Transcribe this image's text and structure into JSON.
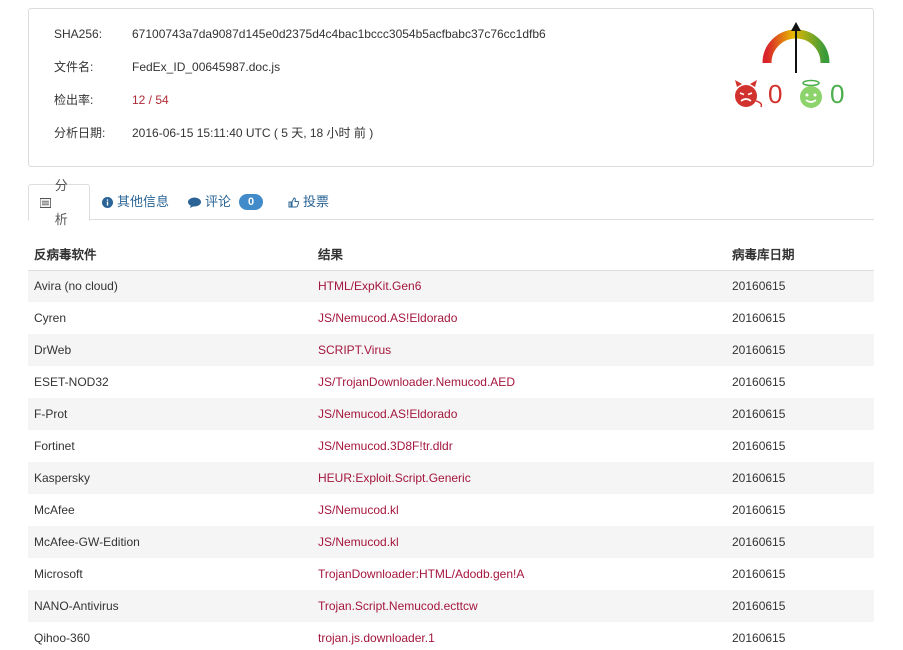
{
  "file_info": {
    "sha256_label": "SHA256:",
    "sha256_value": "67100743a7da9087d145e0d2375d4c4bac1bccc3054b5acfbabc37c76cc1dfb6",
    "filename_label": "文件名:",
    "filename_value": "FedEx_ID_00645987.doc.js",
    "detection_label": "检出率:",
    "detection_value": "12 / 54",
    "date_label": "分析日期:",
    "date_value": "2016-06-15 15:11:40 UTC ( 5 天, 18 小时 前 )"
  },
  "community": {
    "malicious_votes": "0",
    "harmless_votes": "0",
    "colors": {
      "malicious": "#d2322d",
      "harmless": "#4cae4c"
    }
  },
  "tabs": [
    {
      "label": "分析",
      "icon": "list-icon",
      "active": true
    },
    {
      "label": "其他信息",
      "icon": "info-icon",
      "active": false
    },
    {
      "label": "评论",
      "icon": "comment-icon",
      "active": false,
      "badge": "0"
    },
    {
      "label": "投票",
      "icon": "thumbs-icon",
      "active": false
    }
  ],
  "table": {
    "headers": [
      "反病毒软件",
      "结果",
      "病毒库日期"
    ],
    "rows": [
      {
        "av": "Avira (no cloud)",
        "result": "HTML/ExpKit.Gen6",
        "date": "20160615"
      },
      {
        "av": "Cyren",
        "result": "JS/Nemucod.AS!Eldorado",
        "date": "20160615"
      },
      {
        "av": "DrWeb",
        "result": "SCRIPT.Virus",
        "date": "20160615"
      },
      {
        "av": "ESET-NOD32",
        "result": "JS/TrojanDownloader.Nemucod.AED",
        "date": "20160615"
      },
      {
        "av": "F-Prot",
        "result": "JS/Nemucod.AS!Eldorado",
        "date": "20160615"
      },
      {
        "av": "Fortinet",
        "result": "JS/Nemucod.3D8F!tr.dldr",
        "date": "20160615"
      },
      {
        "av": "Kaspersky",
        "result": "HEUR:Exploit.Script.Generic",
        "date": "20160615"
      },
      {
        "av": "McAfee",
        "result": "JS/Nemucod.kl",
        "date": "20160615"
      },
      {
        "av": "McAfee-GW-Edition",
        "result": "JS/Nemucod.kl",
        "date": "20160615"
      },
      {
        "av": "Microsoft",
        "result": "TrojanDownloader:HTML/Adodb.gen!A",
        "date": "20160615"
      },
      {
        "av": "NANO-Antivirus",
        "result": "Trojan.Script.Nemucod.ecttcw",
        "date": "20160615"
      },
      {
        "av": "Qihoo-360",
        "result": "trojan.js.downloader.1",
        "date": "20160615"
      }
    ]
  }
}
